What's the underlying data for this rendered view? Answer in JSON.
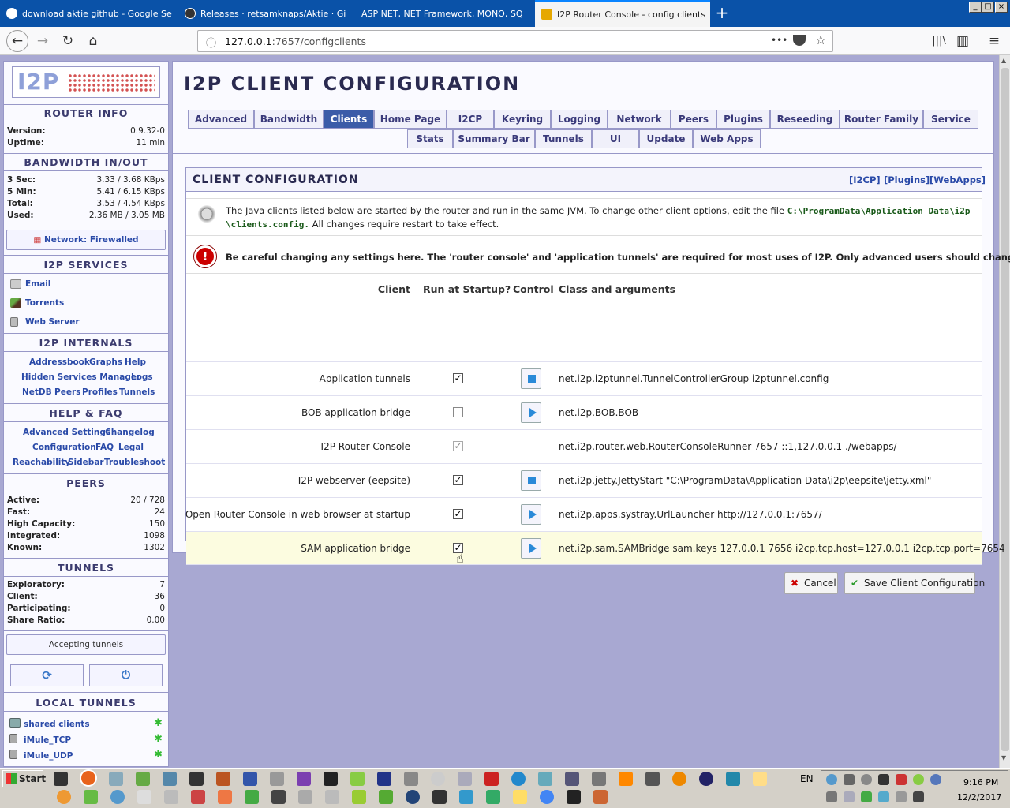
{
  "browser": {
    "tabs": [
      {
        "label": "download aktie github - Google Se",
        "color": "#ffffff"
      },
      {
        "label": "Releases · retsamknaps/Aktie · Gi",
        "color": "#333333"
      },
      {
        "label": "ASP NET, NET Framework, MONO, SQ",
        "color": "#1e6bd6"
      },
      {
        "label": "I2P Router Console - config clients",
        "color": "#e6a800"
      }
    ],
    "new_tab": "+",
    "url_host": "127.0.0.1",
    "url_path": ":7657/configclients",
    "url_menu": "•••",
    "nav": {
      "back": "←",
      "forward": "→",
      "reload": "↻",
      "home": "⌂",
      "library": "|||\\",
      "sidebar": "▥",
      "menu": "≡"
    }
  },
  "sidebar": {
    "logo_text": "I2P",
    "router_info": {
      "title": "ROUTER INFO",
      "rows": [
        {
          "label": "Version:",
          "value": "0.9.32-0"
        },
        {
          "label": "Uptime:",
          "value": "11 min"
        }
      ]
    },
    "bandwidth": {
      "title": "BANDWIDTH IN/OUT",
      "rows": [
        {
          "label": "3 Sec:",
          "value": "3.33 / 3.68 KBps"
        },
        {
          "label": "5 Min:",
          "value": "5.41 / 6.15 KBps"
        },
        {
          "label": "Total:",
          "value": "3.53 / 4.54 KBps"
        },
        {
          "label": "Used:",
          "value": "2.36 MB / 3.05 MB"
        }
      ]
    },
    "network_status": "Network: Firewalled",
    "services": {
      "title": "I2P SERVICES",
      "items": [
        "Email",
        "Torrents",
        "Web Server"
      ]
    },
    "internals": {
      "title": "I2P INTERNALS",
      "links": [
        "Addressbook",
        "Graphs",
        "Help",
        "Hidden Services Manager",
        "Logs",
        "NetDB",
        "Peers",
        "Profiles",
        "Tunnels"
      ]
    },
    "help": {
      "title": "HELP & FAQ",
      "links": [
        "Advanced Settings",
        "Changelog",
        "Configuration",
        "FAQ",
        "Legal",
        "Reachability",
        "Sidebar",
        "Troubleshoot"
      ]
    },
    "peers": {
      "title": "PEERS",
      "rows": [
        {
          "label": "Active:",
          "value": "20 / 728"
        },
        {
          "label": "Fast:",
          "value": "24"
        },
        {
          "label": "High Capacity:",
          "value": "150"
        },
        {
          "label": "Integrated:",
          "value": "1098"
        },
        {
          "label": "Known:",
          "value": "1302"
        }
      ]
    },
    "tunnels": {
      "title": "TUNNELS",
      "rows": [
        {
          "label": "Exploratory:",
          "value": "7"
        },
        {
          "label": "Client:",
          "value": "36"
        },
        {
          "label": "Participating:",
          "value": "0"
        },
        {
          "label": "Share Ratio:",
          "value": "0.00"
        }
      ]
    },
    "accepting": "Accepting tunnels",
    "local_tunnels": {
      "title": "LOCAL TUNNELS",
      "items": [
        "shared clients",
        "iMule_TCP",
        "iMule_UDP"
      ]
    }
  },
  "main": {
    "title": "I2P CLIENT CONFIGURATION",
    "tabs_row1": [
      "Advanced",
      "Bandwidth",
      "Clients",
      "Home Page",
      "I2CP",
      "Keyring",
      "Logging",
      "Network",
      "Peers",
      "Plugins",
      "Reseeding",
      "Router Family",
      "Service"
    ],
    "tabs_row2": [
      "Stats",
      "Summary Bar",
      "Tunnels",
      "UI",
      "Update",
      "Web Apps"
    ],
    "active_tab": "Clients",
    "section": {
      "title": "CLIENT CONFIGURATION",
      "quick_links": [
        "[I2CP]",
        "[Plugins]",
        "[WebApps]"
      ],
      "info_text": "The Java clients listed below are started by the router and run in the same JVM.  To change other client options, edit the file",
      "info_path": "C:\\ProgramData\\Application Data\\i2p",
      "info_path2": "\\clients.config.",
      "info_tail": "All changes require restart to take effect.",
      "warning": "Be careful changing any settings here. The 'router console' and 'application tunnels' are required for most uses of I2P. Only advanced users should change these.",
      "headers": {
        "client": "Client",
        "startup": "Run at Startup?",
        "control": "Control",
        "args": "Class and arguments"
      },
      "rows": [
        {
          "client": "Application tunnels",
          "checked": "✓",
          "control": "stop",
          "args": "net.i2p.i2ptunnel.TunnelControllerGroup i2ptunnel.config"
        },
        {
          "client": "BOB application bridge",
          "checked": "",
          "control": "start",
          "args": "net.i2p.BOB.BOB"
        },
        {
          "client": "I2P Router Console",
          "checked": "✓",
          "control": "none",
          "args": "net.i2p.router.web.RouterConsoleRunner 7657 ::1,127.0.0.1 ./webapps/"
        },
        {
          "client": "I2P webserver (eepsite)",
          "checked": "✓",
          "control": "stop",
          "args": "net.i2p.jetty.JettyStart \"C:\\ProgramData\\Application Data\\i2p\\eepsite\\jetty.xml\""
        },
        {
          "client": "Open Router Console in web browser at startup",
          "checked": "✓",
          "control": "start",
          "args": "net.i2p.apps.systray.UrlLauncher http://127.0.0.1:7657/"
        },
        {
          "client": "SAM application bridge",
          "checked": "✓",
          "control": "start",
          "args": "net.i2p.sam.SAMBridge sam.keys 127.0.0.1 7656 i2cp.tcp.host=127.0.0.1 i2cp.tcp.port=7654"
        }
      ],
      "cancel": "Cancel",
      "save": "Save Client Configuration"
    }
  },
  "taskbar": {
    "start": "Start",
    "lang": "EN",
    "time": "9:16 PM",
    "date": "12/2/2017"
  },
  "colors": {
    "accent": "#3b5ca8",
    "tabbar": "#0a52a8",
    "page_bg": "#a8a8d2",
    "highlight_row": "#fcfce0"
  }
}
